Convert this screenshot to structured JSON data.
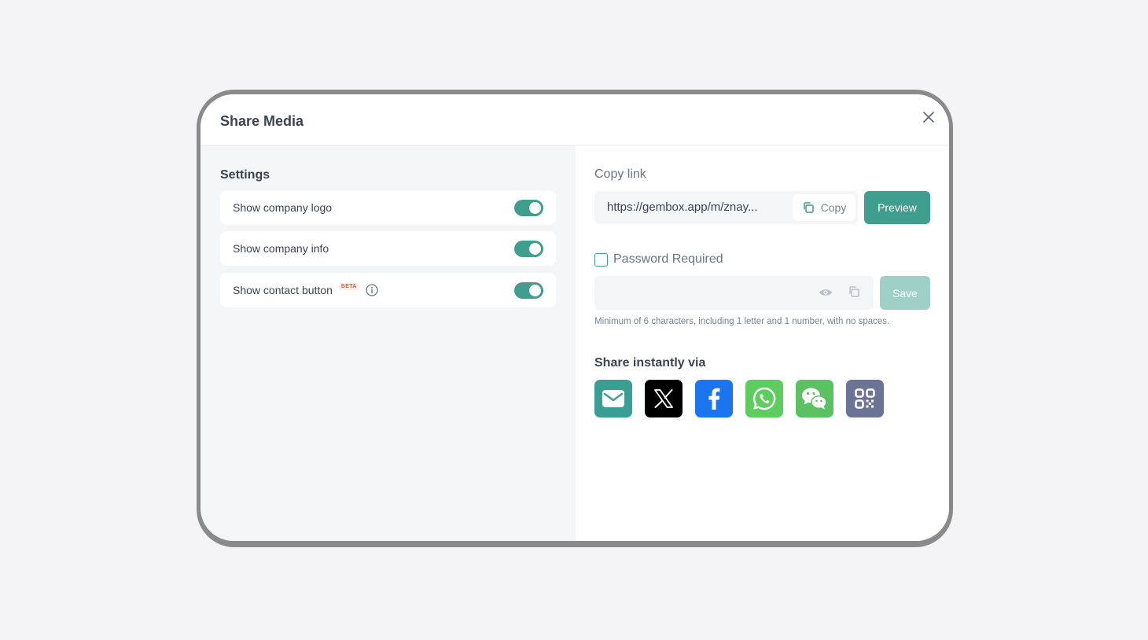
{
  "modal": {
    "title": "Share Media"
  },
  "settings": {
    "title": "Settings",
    "items": [
      {
        "label": "Show company logo",
        "enabled": true
      },
      {
        "label": "Show company info",
        "enabled": true
      },
      {
        "label": "Show contact button",
        "badge": "BETA",
        "enabled": true
      }
    ]
  },
  "copy_link": {
    "label": "Copy link",
    "url": "https://gembox.app/m/znay...",
    "copy_label": "Copy",
    "preview_label": "Preview"
  },
  "password": {
    "label": "Password Required",
    "checked": false,
    "value": "",
    "save_label": "Save",
    "hint": "Minimum of 6 characters, including 1 letter and 1 number, with no spaces."
  },
  "share": {
    "title": "Share instantly via",
    "channels": [
      {
        "name": "email",
        "icon": "email-icon",
        "color": "#3a9e95"
      },
      {
        "name": "x",
        "icon": "x-icon",
        "color": "#000000"
      },
      {
        "name": "facebook",
        "icon": "facebook-icon",
        "color": "#1b74f0"
      },
      {
        "name": "whatsapp",
        "icon": "whatsapp-icon",
        "color": "#5dcd5f"
      },
      {
        "name": "wechat",
        "icon": "wechat-icon",
        "color": "#5bc163"
      },
      {
        "name": "qr-code",
        "icon": "qr-code-icon",
        "color": "#6c7496"
      }
    ]
  },
  "colors": {
    "accent": "#3f9e8e",
    "accent_disabled": "#9fd0c7"
  }
}
